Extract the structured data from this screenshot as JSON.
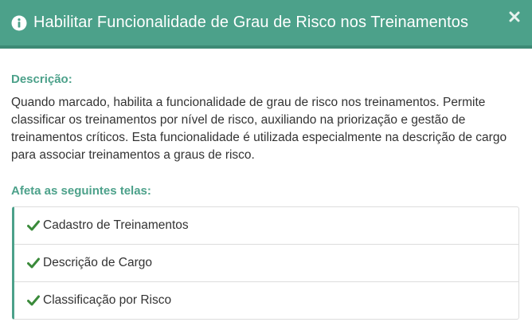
{
  "header": {
    "title": "Habilitar Funcionalidade de Grau de Risco nos Treinamentos",
    "icon": "info-circle-icon",
    "close_icon": "close-icon"
  },
  "description": {
    "label": "Descrição:",
    "text": "Quando marcado, habilita a funcionalidade de grau de risco nos treinamentos. Permite classificar os treinamentos por nível de risco, auxiliando na priorização e gestão de treinamentos críticos. Esta funcionalidade é utilizada especialmente na descrição de cargo para associar treinamentos a graus de risco."
  },
  "affects": {
    "label": "Afeta as seguintes telas:",
    "items": [
      {
        "icon": "check-icon",
        "label": "Cadastro de Treinamentos"
      },
      {
        "icon": "check-icon",
        "label": "Descrição de Cargo"
      },
      {
        "icon": "check-icon",
        "label": "Classificação por Risco"
      }
    ]
  },
  "colors": {
    "header_bg": "#4ca18a",
    "accent": "#4ca18a",
    "check": "#3a8a3a"
  }
}
